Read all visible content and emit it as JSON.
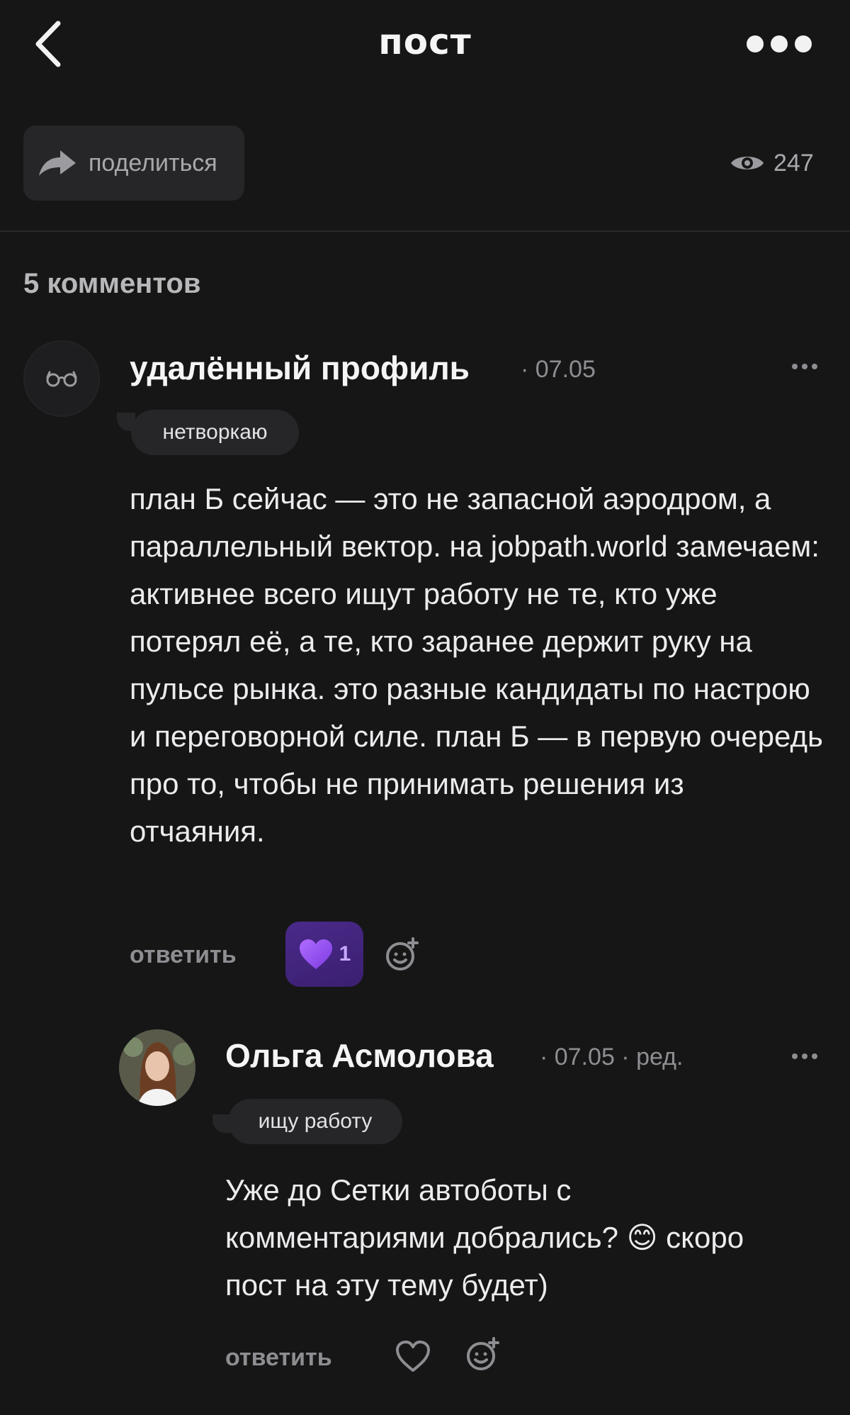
{
  "header": {
    "title": "пост"
  },
  "share": {
    "label": "поделиться"
  },
  "views": {
    "count": "247"
  },
  "comments": {
    "count_label": "5 комментов",
    "items": [
      {
        "author": "удалённый профиль",
        "meta": "· 07.05",
        "tag": "нетворкаю",
        "text": "план Б сейчас — это не запасной аэродром, а параллельный вектор. на jobpath.world замечаем: активнее всего ищут работу не те, кто уже потерял её, а те, кто заранее держит руку на пульсе рынка. это разные кандидаты по настрою и переговорной силе. план Б — в первую очередь про то, чтобы не принимать решения из отчаяния.",
        "reply_label": "ответить",
        "reaction_count": "1"
      },
      {
        "author": "Ольга Асмолова",
        "meta": "· 07.05 · ред.",
        "tag": "ищу работу",
        "text": "Уже до Сетки автоботы с комментариями добрались? 😊 скоро пост на эту тему будет)",
        "reply_label": "ответить"
      }
    ]
  }
}
